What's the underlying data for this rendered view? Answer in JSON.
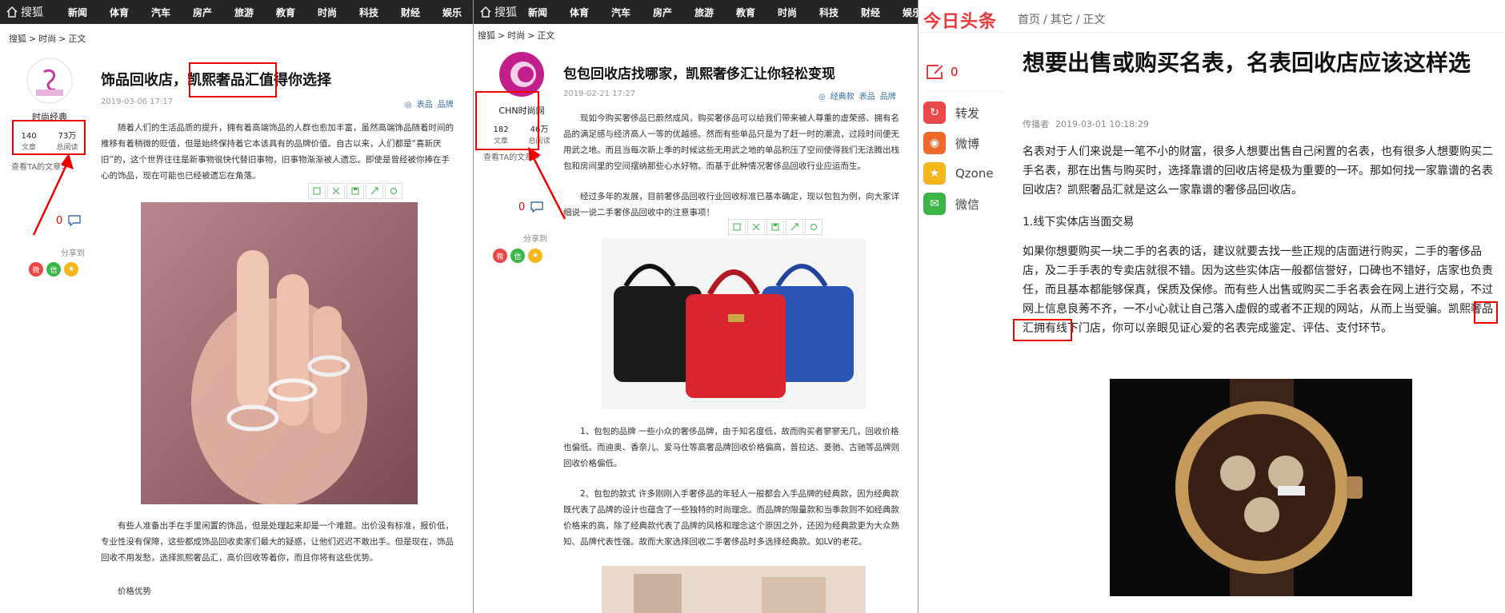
{
  "panel1": {
    "logo": "搜狐",
    "nav": [
      "新闻",
      "体育",
      "汽车",
      "房产",
      "旅游",
      "教育",
      "时尚",
      "科技",
      "财经",
      "娱乐"
    ],
    "breadcrumb": [
      "搜狐",
      "时尚",
      "正文"
    ],
    "author": {
      "name": "时尚经典",
      "articles": "140",
      "articles_label": "文章",
      "reads": "73万",
      "reads_label": "总阅读",
      "more": "查看TA的文章>"
    },
    "title": "饰品回收店，凯熙奢品汇值得你选择",
    "date": "2019-03-06 17:17",
    "tags": [
      "表品",
      "品牌"
    ],
    "para1": "随着人们的生活品质的提升，拥有着高端饰品的人群也愈加丰富，虽然高端饰品随着时间的推移有着稍微的贬值，但是始终保持着它本该具有的品牌价值。自古以来，人们都是“喜新厌旧”的，这个世界往往是新事物很快代替旧事物，旧事物渐渐被人遗忘。即使是曾经被你捧在手心的饰品，现在可能也已经被遗忘在角落。",
    "comment_count": "0",
    "share_label": "分享到",
    "para2": "有些人准备出手在手里闲置的饰品，但是处理起来却是一个难题。出价没有标准，报价低，专业性没有保障，这些都成饰品回收卖家们最大的疑惑，让他们迟迟不敢出手。但是现在，饰品回收不用发愁，选择凯熙奢品汇，高价回收等着你，而且你将有这些优势。",
    "subheading": "价格优势"
  },
  "panel2": {
    "logo": "搜狐",
    "nav": [
      "新闻",
      "体育",
      "汽车",
      "房产",
      "旅游",
      "教育",
      "时尚",
      "科技",
      "财经",
      "娱乐"
    ],
    "breadcrumb": [
      "搜狐",
      "时尚",
      "正文"
    ],
    "author": {
      "name": "CHN时尚网",
      "articles": "182",
      "articles_label": "文章",
      "reads": "46万",
      "reads_label": "总阅读",
      "more": "查看TA的文章>"
    },
    "title": "包包回收店找哪家，凯熙奢侈汇让你轻松变现",
    "date": "2019-02-21 17:27",
    "tags": [
      "经典款",
      "表品",
      "品牌"
    ],
    "para1": "现如今购买奢侈品已蔚然成风，购买奢侈品可以给我们带来被人尊重的虚荣感、拥有名品的满足感与经济高人一等的优越感。然而有些单品只是为了赶一时的潮流，过段时间便无用武之地。而且当每次新上季的时候这些无用武之地的单品积压了空间使得我们无法腾出栈包和房间里的空间摆纳那些心水好物。而基于此种情况奢侈品回收行业应运而生。",
    "para2": "经过多年的发展，目前奢侈品回收行业回收标准已基本确定，现以包包为例，向大家详细说一说二手奢侈品回收中的注意事项！",
    "comment_count": "0",
    "share_label": "分享到",
    "para3": "1、包包的品牌 一些小众的奢侈品牌，由于知名度低，故而购买者寥寥无几，回收价格也偏低。而迪奥、香奈儿、爱马仕等高奢品牌回收价格偏高，普拉达、菱驰、古驰等品牌则回收价格偏低。",
    "para4": "2、包包的款式 许多刚刚入手奢侈品的年轻人一般都会入手品牌的经典款，因为经典款既代表了品牌的设计也蕴含了一些独特的时尚理念。而品牌的限量款和当季款则不如经典款价格来的高，除了经典款代表了品牌的风格和理念这个原因之外，还因为经典款更为大众熟知、品牌代表性强。故而大家选择回收二手奢侈品时多选择经典款。如LV的老花。"
  },
  "panel3": {
    "logo": "今日头条",
    "breadcrumb": [
      "首页",
      "其它",
      "正文"
    ],
    "comment_count": "0",
    "share": [
      {
        "label": "转发",
        "color": "#e84a4a",
        "icon": "repost-icon"
      },
      {
        "label": "微博",
        "color": "#f06a2a",
        "icon": "weibo-icon"
      },
      {
        "label": "Qzone",
        "color": "#f5b51c",
        "icon": "qzone-icon"
      },
      {
        "label": "微信",
        "color": "#3bb54a",
        "icon": "wechat-icon"
      }
    ],
    "title": "想要出售或购买名表，名表回收店应该这样选",
    "source": "传播者",
    "date": "2019-03-01 10:18:29",
    "para1": "名表对于人们来说是一笔不小的财富，很多人想要出售自己闲置的名表，也有很多人想要购买二手名表，那在出售与购买时，选择靠谱的回收店将是极为重要的一环。那如何找一家靠谱的名表回收店？凯熙奢品汇就是这么一家靠谱的奢侈品回收店。",
    "heading": "1.线下实体店当面交易",
    "para2": "如果你想要购买一块二手的名表的话，建议就要去找一些正规的店面进行购买，二手的奢侈品店，及二手手表的专卖店就很不错。因为这些实体店一般都信誉好，口碑也不错好，店家也负责任，而且基本都能够保真，保质及保修。而有些人出售或购买二手名表会在网上进行交易，不过网上信息良莠不齐，一不小心就让自己落入虚假的或者不正规的网站，从而上当受骗。凯熙奢品汇拥有线下门店，你可以亲眼见证心爱的名表完成鉴定、评估、支付环节。"
  },
  "colors": {
    "red_annotation": "#e00000",
    "nav_bg": "#252525",
    "toutiao_red": "#e83a3a",
    "link_blue": "#3b6ea8"
  }
}
